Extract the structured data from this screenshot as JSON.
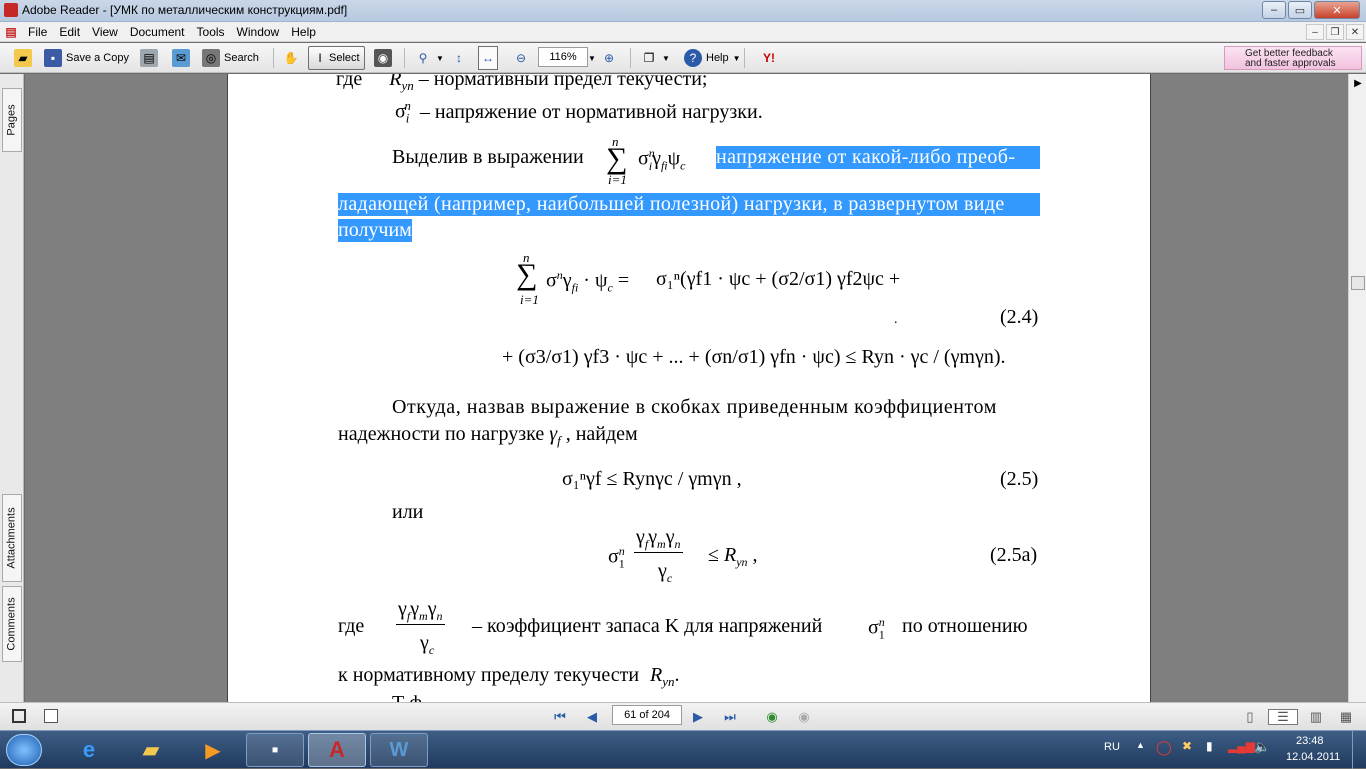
{
  "window": {
    "title": "Adobe Reader - [УМК по металлическим конструкциям.pdf]"
  },
  "menu": [
    "File",
    "Edit",
    "View",
    "Document",
    "Tools",
    "Window",
    "Help"
  ],
  "toolbar": {
    "save_copy": "Save a Copy",
    "search": "Search",
    "select": "Select",
    "zoom": "116%",
    "help": "Help"
  },
  "promo": {
    "line1": "Get better feedback",
    "line2": "and faster approvals"
  },
  "side_tabs": {
    "pages": "Pages",
    "attachments": "Attachments",
    "comments": "Comments"
  },
  "document": {
    "l1_where": "где",
    "l1": "R",
    "l1_sub": "yn",
    "l1_text": "– нормативный предел текучести;",
    "l2_sigma": "σ",
    "l2_sub": "i",
    "l2_sup": "n",
    "l2_text": "– напряжение от нормативной нагрузки.",
    "p1_start": "Выделив в выражении",
    "p1_sum_top": "n",
    "p1_sum_bottom": "i=1",
    "p1_expr": "σ",
    "p1_expr_rest": "γ",
    "p1_sel1": "напряжение от какой-либо преоб-",
    "p1_sel2": "ладающей (например, наибольшей полезной) нагрузки, в развернутом виде",
    "p1_sel3": "получим",
    "eq24_line1": "σ₁ⁿ(γf1 · ψc + (σ2/σ1) γf2ψc +",
    "eq24_line2": "+ (σ3/σ1) γf3 · ψc + ... + (σn/σ1) γfn · ψc) ≤ Ryn · γc / (γmγn).",
    "eq24_num": "(2.4)",
    "p2_l1": "Откуда, назвав выражение в скобках приведенным коэффициентом",
    "p2_l2": "надежности по нагрузке",
    "p2_l2_end": ", найдем",
    "eq25": "σ₁ⁿγf ≤ Rynγc / γmγn ,",
    "eq25_num": "(2.5)",
    "or": "или",
    "eq25a_num": "(2.5a)",
    "p3_where": "где",
    "p3_text": "– коэффициент запаса K для напряжений",
    "p3_end": "по отношению",
    "p4": "к нормативному пределу текучести",
    "p5_partial": "Т                              ф"
  },
  "status": {
    "page": "61 of 204"
  },
  "tray": {
    "lang": "RU",
    "time": "23:48",
    "date": "12.04.2011"
  }
}
